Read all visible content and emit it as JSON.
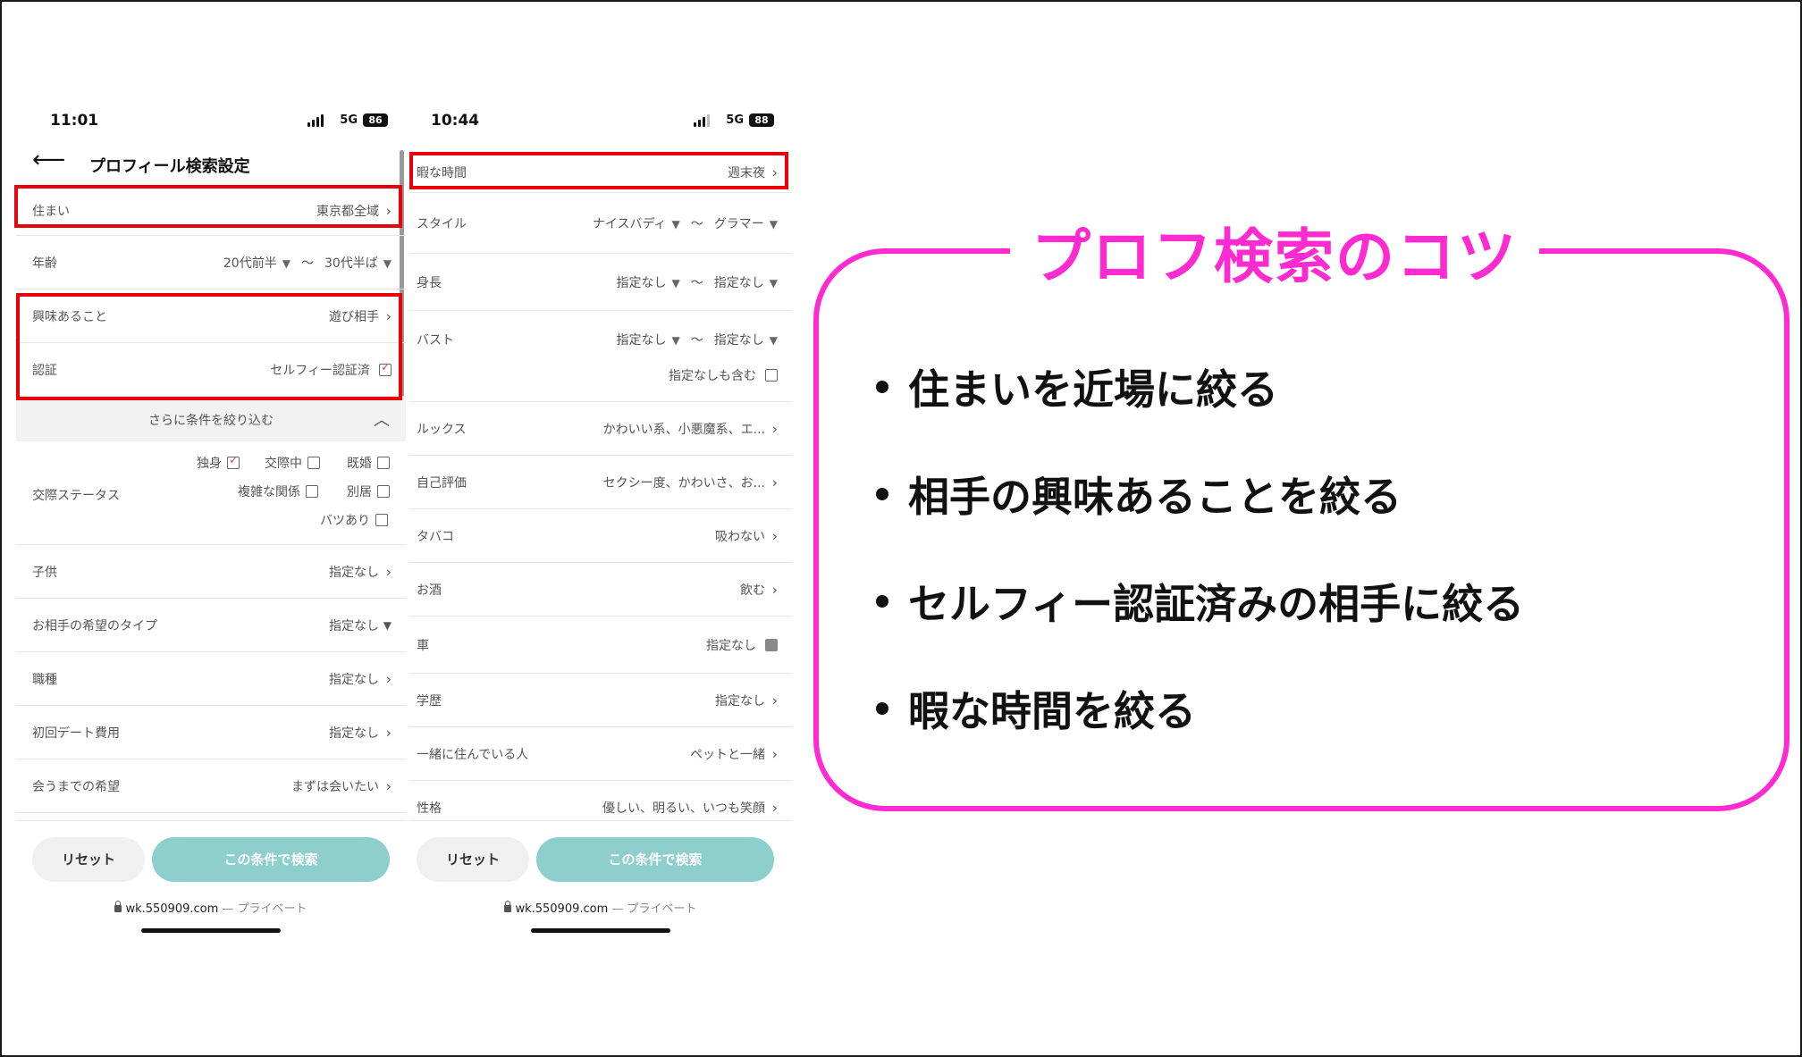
{
  "phone1": {
    "status": {
      "time": "11:01",
      "network": "5G",
      "battery": "86"
    },
    "header": {
      "title": "プロフィール検索設定"
    },
    "rows": {
      "residence": {
        "label": "住まい",
        "value": "東京都全域"
      },
      "age": {
        "label": "年齢",
        "from": "20代前半",
        "to": "30代半ば"
      },
      "interest": {
        "label": "興味あること",
        "value": "遊び相手"
      },
      "verify": {
        "label": "認証",
        "value": "セルフィー認証済"
      }
    },
    "more": {
      "label": "さらに条件を絞り込む"
    },
    "relationship": {
      "label": "交際ステータス",
      "options": [
        "独身",
        "交際中",
        "既婚",
        "複雑な関係",
        "別居",
        "バツあり"
      ]
    },
    "rows2": [
      {
        "label": "子供",
        "value": "指定なし"
      },
      {
        "label": "お相手の希望のタイプ",
        "value": "指定なし"
      },
      {
        "label": "職種",
        "value": "指定なし"
      },
      {
        "label": "初回デート費用",
        "value": "指定なし"
      },
      {
        "label": "会うまでの希望",
        "value": "まずは会いたい"
      }
    ],
    "footer": {
      "reset": "リセット",
      "search": "この条件で検索",
      "url": "wk.550909.com",
      "private": " — プライベート"
    }
  },
  "phone2": {
    "status": {
      "time": "10:44",
      "network": "5G",
      "battery": "88"
    },
    "free_time": {
      "label": "暇な時間",
      "value": "週末夜"
    },
    "style": {
      "label": "スタイル",
      "from": "ナイスバディ",
      "to": "グラマー"
    },
    "height": {
      "label": "身長",
      "from": "指定なし",
      "to": "指定なし"
    },
    "bust": {
      "label": "バスト",
      "from": "指定なし",
      "to": "指定なし",
      "include": "指定なしも含む"
    },
    "rows": [
      {
        "label": "ルックス",
        "value": "かわいい系、小悪魔系、エ..."
      },
      {
        "label": "自己評価",
        "value": "セクシー度、かわいさ、お..."
      },
      {
        "label": "タバコ",
        "value": "吸わない"
      },
      {
        "label": "お酒",
        "value": "飲む"
      }
    ],
    "car": {
      "label": "車",
      "value": "指定なし"
    },
    "rows2": [
      {
        "label": "学歴",
        "value": "指定なし"
      },
      {
        "label": "一緒に住んでいる人",
        "value": "ペットと一緒"
      },
      {
        "label": "性格",
        "value": "優しい、明るい、いつも笑顔"
      }
    ],
    "footer": {
      "reset": "リセット",
      "search": "この条件で検索",
      "url": "wk.550909.com",
      "private": " — プライベート"
    }
  },
  "tipcard": {
    "title": "プロフ検索のコツ",
    "tips": [
      "住まいを近場に絞る",
      "相手の興味あることを絞る",
      "セルフィー認証済みの相手に絞る",
      "暇な時間を絞る"
    ]
  },
  "colors": {
    "highlight": "#e8000b",
    "accent": "#ff2ad0",
    "button": "#8ccfcd"
  }
}
